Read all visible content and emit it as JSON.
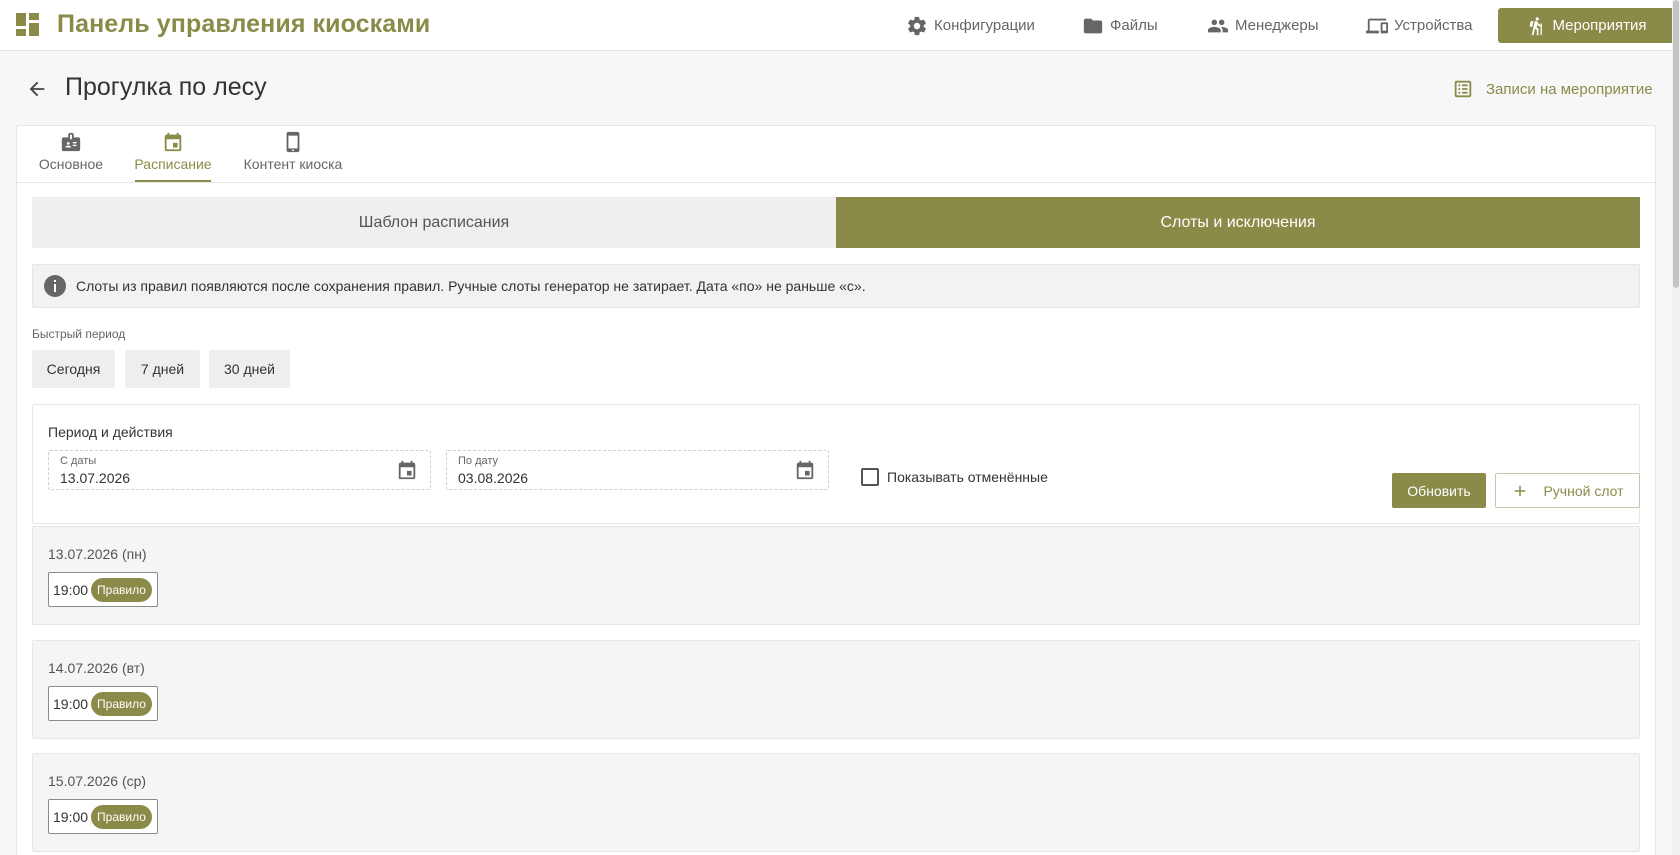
{
  "header": {
    "app_title": "Панель управления киосками",
    "nav": [
      {
        "label": "Конфигурации",
        "icon": "gear-icon"
      },
      {
        "label": "Файлы",
        "icon": "folder-icon"
      },
      {
        "label": "Менеджеры",
        "icon": "people-icon"
      },
      {
        "label": "Устройства",
        "icon": "devices-icon"
      }
    ],
    "active_nav": {
      "label": "Мероприятия",
      "icon": "hiking-icon"
    }
  },
  "page": {
    "title": "Прогулка по лесу",
    "records_link": "Записи на мероприятие"
  },
  "tabs": [
    {
      "label": "Основное",
      "icon": "badge-icon"
    },
    {
      "label": "Расписание",
      "icon": "calendar-icon",
      "active": true
    },
    {
      "label": "Контент киоска",
      "icon": "tablet-icon"
    }
  ],
  "segments": {
    "left": "Шаблон расписания",
    "right": "Слоты и исключения"
  },
  "info_text": "Слоты из правил появляются после сохранения правил. Ручные слоты генератор не затирает. Дата «по» не раньше «с».",
  "quick_period": {
    "label": "Быстрый период",
    "buttons": [
      "Сегодня",
      "7 дней",
      "30 дней"
    ]
  },
  "period": {
    "title": "Период и действия",
    "from_label": "С даты",
    "from_value": "13.07.2026",
    "to_label": "По дату",
    "to_value": "03.08.2026",
    "show_cancelled": "Показывать отменённые",
    "refresh": "Обновить",
    "manual_slot": "Ручной слот"
  },
  "days": [
    {
      "date": "13.07.2026 (пн)",
      "slots": [
        {
          "time": "19:00",
          "badge": "Правило"
        }
      ]
    },
    {
      "date": "14.07.2026 (вт)",
      "slots": [
        {
          "time": "19:00",
          "badge": "Правило"
        }
      ]
    },
    {
      "date": "15.07.2026 (ср)",
      "slots": [
        {
          "time": "19:00",
          "badge": "Правило"
        }
      ]
    }
  ],
  "colors": {
    "accent": "#8a8b48"
  }
}
